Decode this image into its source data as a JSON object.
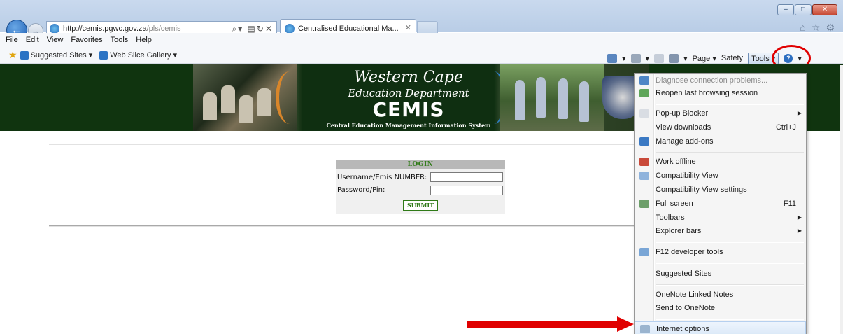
{
  "browser": {
    "address": {
      "host": "http://cemis.pgwc.gov.za",
      "path": "/pls/cemis"
    },
    "tab": {
      "title": "Centralised Educational Ma..."
    },
    "menubar": [
      "File",
      "Edit",
      "View",
      "Favorites",
      "Tools",
      "Help"
    ],
    "favorites": {
      "suggested_sites": "Suggested Sites ▾",
      "web_slice_gallery": "Web Slice Gallery ▾"
    },
    "commandbar": {
      "page": "Page ▾",
      "safety": "Safety",
      "tools": "Tools ▾"
    },
    "window_controls": {
      "minimize": "–",
      "maximize": "□",
      "close": "✕"
    },
    "accent": "#e00000"
  },
  "banner": {
    "line1": "Western Cape",
    "line2": "Education Department",
    "line3": "CEMIS",
    "line4": "Central Education Management Information System"
  },
  "login": {
    "heading": "LOGIN",
    "username_label": "Username/Emis NUMBER:",
    "password_label": "Password/Pin:",
    "username_value": "",
    "password_value": "",
    "submit_label": "SUBMIT"
  },
  "tools_menu": {
    "items": [
      {
        "label": "Diagnose connection problems...",
        "shortcut": "",
        "submenu": false,
        "disabled": true
      },
      {
        "label": "Reopen last browsing session",
        "shortcut": "",
        "submenu": false
      },
      {
        "label": "Pop-up Blocker",
        "shortcut": "",
        "submenu": true
      },
      {
        "label": "View downloads",
        "shortcut": "Ctrl+J",
        "submenu": false
      },
      {
        "label": "Manage add-ons",
        "shortcut": "",
        "submenu": false
      },
      {
        "label": "Work offline",
        "shortcut": "",
        "submenu": false
      },
      {
        "label": "Compatibility View",
        "shortcut": "",
        "submenu": false
      },
      {
        "label": "Compatibility View settings",
        "shortcut": "",
        "submenu": false
      },
      {
        "label": "Full screen",
        "shortcut": "F11",
        "submenu": false
      },
      {
        "label": "Toolbars",
        "shortcut": "",
        "submenu": true
      },
      {
        "label": "Explorer bars",
        "shortcut": "",
        "submenu": true
      },
      {
        "label": "F12 developer tools",
        "shortcut": "",
        "submenu": false
      },
      {
        "label": "Suggested Sites",
        "shortcut": "",
        "submenu": false
      },
      {
        "label": "OneNote Linked Notes",
        "shortcut": "",
        "submenu": false
      },
      {
        "label": "Send to OneNote",
        "shortcut": "",
        "submenu": false
      },
      {
        "label": "Internet options",
        "shortcut": "",
        "submenu": false,
        "highlighted": true
      }
    ]
  }
}
